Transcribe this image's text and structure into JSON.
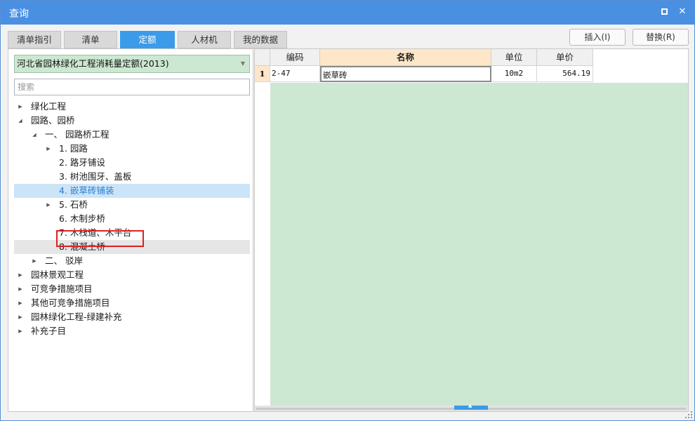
{
  "window": {
    "title": "查询",
    "maximize_icon": "maximize-icon",
    "close_icon": "close-icon",
    "close_glyph": "✕"
  },
  "tabs": [
    {
      "label": "清单指引",
      "active": false
    },
    {
      "label": "清单",
      "active": false
    },
    {
      "label": "定额",
      "active": true
    },
    {
      "label": "人材机",
      "active": false
    },
    {
      "label": "我的数据",
      "active": false
    }
  ],
  "actions": {
    "insert_label": "插入(I)",
    "replace_label": "替换(R)"
  },
  "library": {
    "selected": "河北省园林绿化工程消耗量定额(2013)",
    "dropdown_icon": "triangle-down-icon"
  },
  "search": {
    "placeholder": "搜索",
    "value": ""
  },
  "tree": [
    {
      "label": "绿化工程",
      "toggle": "collapsed"
    },
    {
      "label": "园路、园桥",
      "toggle": "expanded"
    },
    {
      "label": "一、 园路桥工程",
      "toggle": "expanded"
    },
    {
      "label": "1. 园路",
      "toggle": "collapsed"
    },
    {
      "label": "2. 路牙铺设",
      "toggle": "none"
    },
    {
      "label": "3. 树池围牙、盖板",
      "toggle": "none"
    },
    {
      "label": "4. 嵌草砖铺装",
      "toggle": "none",
      "state": "selected"
    },
    {
      "label": "5. 石桥",
      "toggle": "collapsed"
    },
    {
      "label": "6. 木制步桥",
      "toggle": "none"
    },
    {
      "label": "7. 木栈道、木平台",
      "toggle": "none"
    },
    {
      "label": "8. 混凝土桥",
      "toggle": "none",
      "state": "hovered"
    },
    {
      "label": "二、 驳岸",
      "toggle": "collapsed"
    },
    {
      "label": "园林景观工程",
      "toggle": "collapsed"
    },
    {
      "label": "可竞争措施项目",
      "toggle": "collapsed"
    },
    {
      "label": "其他可竞争措施项目",
      "toggle": "collapsed"
    },
    {
      "label": "园林绿化工程-绿建补充",
      "toggle": "collapsed"
    },
    {
      "label": "补充子目",
      "toggle": "collapsed"
    }
  ],
  "table": {
    "columns": [
      "编码",
      "名称",
      "单位",
      "单价"
    ],
    "active_column": "名称",
    "rows": [
      {
        "index": "1",
        "code": "2-47",
        "name": "嵌草砖",
        "unit": "10m2",
        "price": "564.19"
      }
    ]
  },
  "colors": {
    "accent": "#3b9be8",
    "title_bar": "#4a90e2",
    "grid_green": "#cde8d2",
    "selection": "#cce4f7",
    "highlight_border": "#e02020"
  }
}
